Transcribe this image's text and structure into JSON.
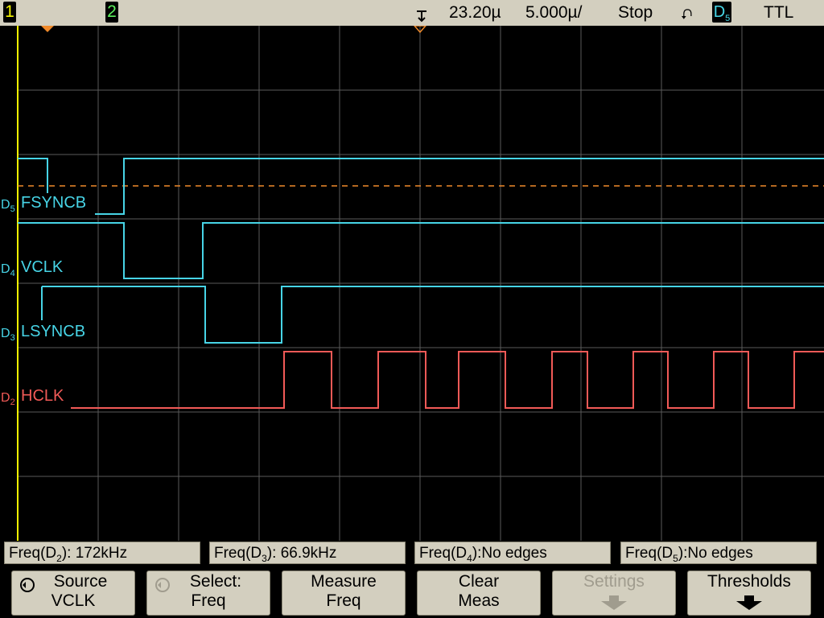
{
  "topbar": {
    "ch1": "1",
    "ch2": "2",
    "delay": "23.20µ",
    "scale": "5.000µ/",
    "status": "Stop",
    "edge_symbol": "⮏",
    "trigger_source_base": "D",
    "trigger_source_sub": "5",
    "logic": "TTL"
  },
  "channels": [
    {
      "id_base": "D",
      "id_sub": "5",
      "label": "FSYNCB",
      "color": "#47d4e6"
    },
    {
      "id_base": "D",
      "id_sub": "4",
      "label": "VCLK",
      "color": "#47d4e6"
    },
    {
      "id_base": "D",
      "id_sub": "3",
      "label": "LSYNCB",
      "color": "#47d4e6"
    },
    {
      "id_base": "D",
      "id_sub": "2",
      "label": "HCLK",
      "color": "#f15a57"
    }
  ],
  "measurements": [
    {
      "prefix": "Freq(D",
      "sub": "2",
      "suffix": "): 172kHz"
    },
    {
      "prefix": "Freq(D",
      "sub": "3",
      "suffix": "): 66.9kHz"
    },
    {
      "prefix": "Freq(D",
      "sub": "4",
      "suffix": "):No edges"
    },
    {
      "prefix": "Freq(D",
      "sub": "5",
      "suffix": "):No edges"
    }
  ],
  "softkeys": [
    {
      "line1": "Source",
      "line2": "VCLK"
    },
    {
      "line1": "Select:",
      "line2": "Freq"
    },
    {
      "line1": "Measure",
      "line2": "Freq"
    },
    {
      "line1": "Clear",
      "line2": "Meas"
    },
    {
      "line1": "Settings",
      "line2": ""
    },
    {
      "line1": "Thresholds",
      "line2": ""
    }
  ],
  "colors": {
    "background": "#000000",
    "grid": "#5a5a5a",
    "digital_cyan": "#47d4e6",
    "digital_red": "#f15a57",
    "trigger_marker": "#f08a2a",
    "softkey_bg": "#d3cfbf"
  },
  "icons": {
    "source_knob": "rotary-knob-icon",
    "select_knob": "rotary-knob-icon",
    "settings_arrow": "down-arrow-icon",
    "thresholds_arrow": "down-arrow-icon"
  }
}
